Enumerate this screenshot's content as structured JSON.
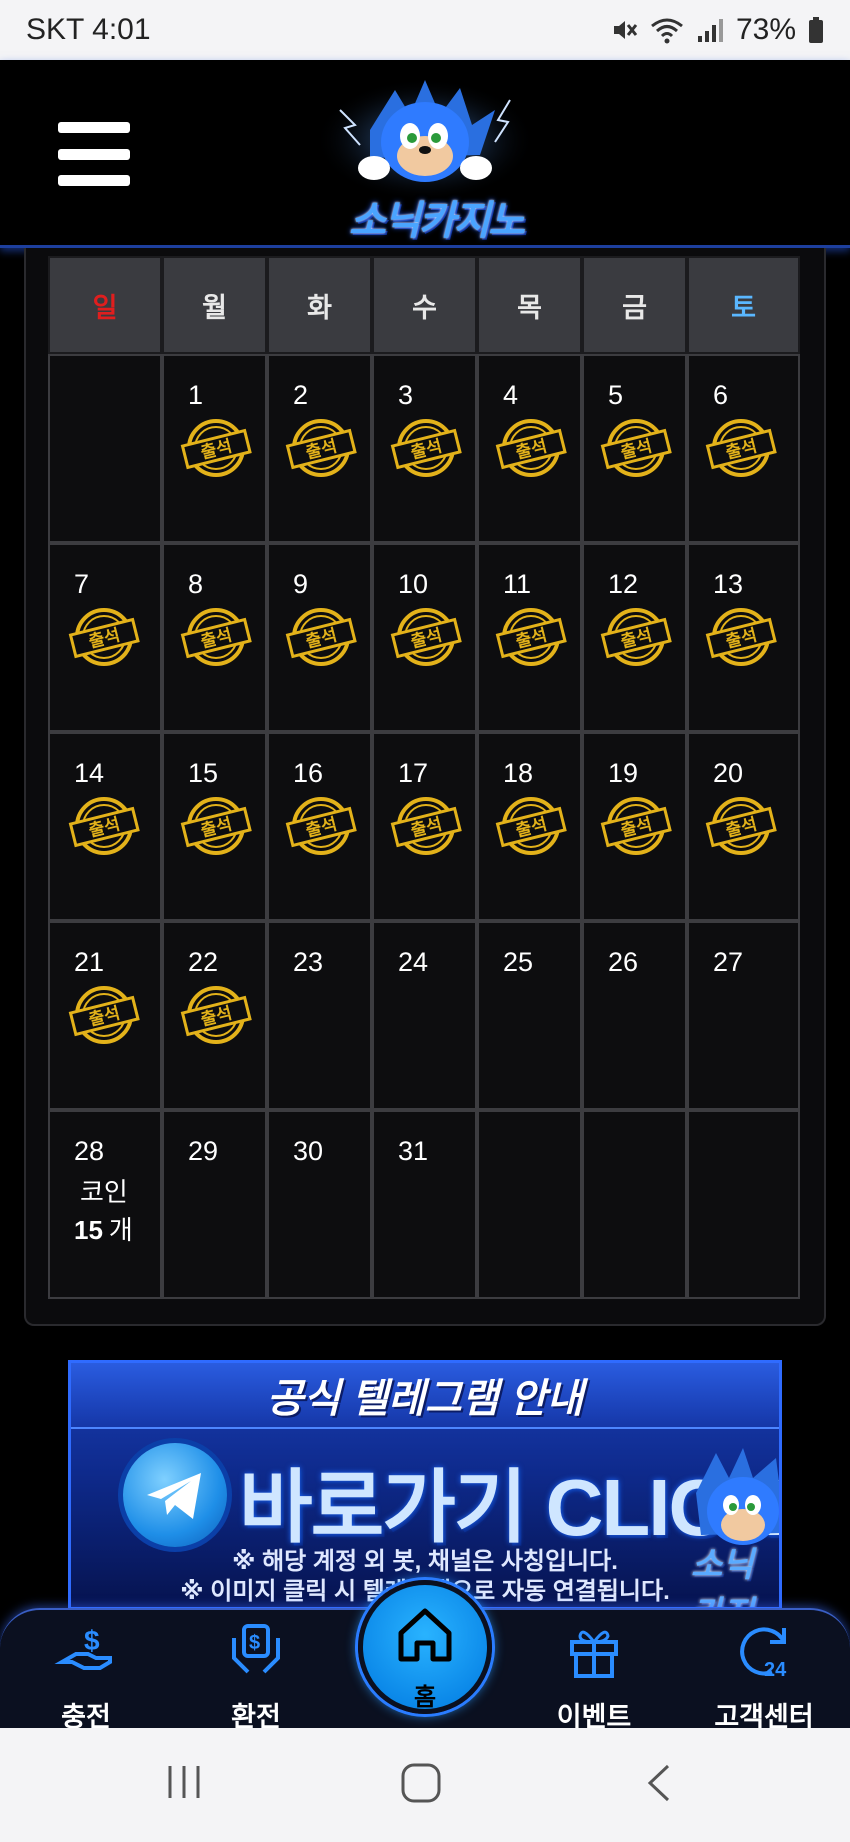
{
  "status_bar": {
    "carrier_time": "SKT 4:01",
    "battery": "73%",
    "icons": [
      "mute-icon",
      "wifi-icon",
      "signal-icon",
      "battery-icon"
    ]
  },
  "header": {
    "menu_icon": "hamburger-menu-icon",
    "logo_text": "소닉카지노"
  },
  "calendar": {
    "weekdays": [
      "일",
      "월",
      "화",
      "수",
      "목",
      "금",
      "토"
    ],
    "colors": {
      "sunday": "#e01e1e",
      "saturday": "#5ab7ff",
      "stamp": "#e3b21a"
    },
    "stamp_text": "출석",
    "days": [
      {
        "day": "",
        "stamp": false
      },
      {
        "day": "1",
        "stamp": true
      },
      {
        "day": "2",
        "stamp": true
      },
      {
        "day": "3",
        "stamp": true
      },
      {
        "day": "4",
        "stamp": true
      },
      {
        "day": "5",
        "stamp": true
      },
      {
        "day": "6",
        "stamp": true
      },
      {
        "day": "7",
        "stamp": true
      },
      {
        "day": "8",
        "stamp": true
      },
      {
        "day": "9",
        "stamp": true
      },
      {
        "day": "10",
        "stamp": true
      },
      {
        "day": "11",
        "stamp": true
      },
      {
        "day": "12",
        "stamp": true
      },
      {
        "day": "13",
        "stamp": true
      },
      {
        "day": "14",
        "stamp": true
      },
      {
        "day": "15",
        "stamp": true
      },
      {
        "day": "16",
        "stamp": true
      },
      {
        "day": "17",
        "stamp": true
      },
      {
        "day": "18",
        "stamp": true
      },
      {
        "day": "19",
        "stamp": true
      },
      {
        "day": "20",
        "stamp": true
      },
      {
        "day": "21",
        "stamp": true
      },
      {
        "day": "22",
        "stamp": true
      },
      {
        "day": "23",
        "stamp": false
      },
      {
        "day": "24",
        "stamp": false
      },
      {
        "day": "25",
        "stamp": false
      },
      {
        "day": "26",
        "stamp": false
      },
      {
        "day": "27",
        "stamp": false
      },
      {
        "day": "28",
        "stamp": false,
        "coin_label": "코인",
        "coin_count": "15",
        "coin_unit": "개"
      },
      {
        "day": "29",
        "stamp": false
      },
      {
        "day": "30",
        "stamp": false
      },
      {
        "day": "31",
        "stamp": false
      },
      {
        "day": "",
        "stamp": false
      },
      {
        "day": "",
        "stamp": false
      },
      {
        "day": "",
        "stamp": false
      }
    ]
  },
  "banner": {
    "title": "공식 텔레그램 안내",
    "click_text": "바로가기 CLICK",
    "note1": "※ 해당 계정 외 봇, 채널은 사칭입니다.",
    "note2": "※ 이미지 클릭 시 텔레그램으로 자동 연결됩니다.",
    "mascot_text": "소닉카지",
    "icon": "telegram-icon"
  },
  "bottom_nav": {
    "items": [
      {
        "label": "충전",
        "icon": "deposit-icon"
      },
      {
        "label": "환전",
        "icon": "withdraw-icon"
      },
      {
        "label": "이벤트",
        "icon": "gift-icon"
      },
      {
        "label": "고객센터",
        "icon": "support-24-icon"
      }
    ],
    "home_label": "홈",
    "home_icon": "home-icon"
  },
  "system_nav": {
    "icons": [
      "recent-apps-icon",
      "home-circle-icon",
      "back-icon"
    ]
  }
}
